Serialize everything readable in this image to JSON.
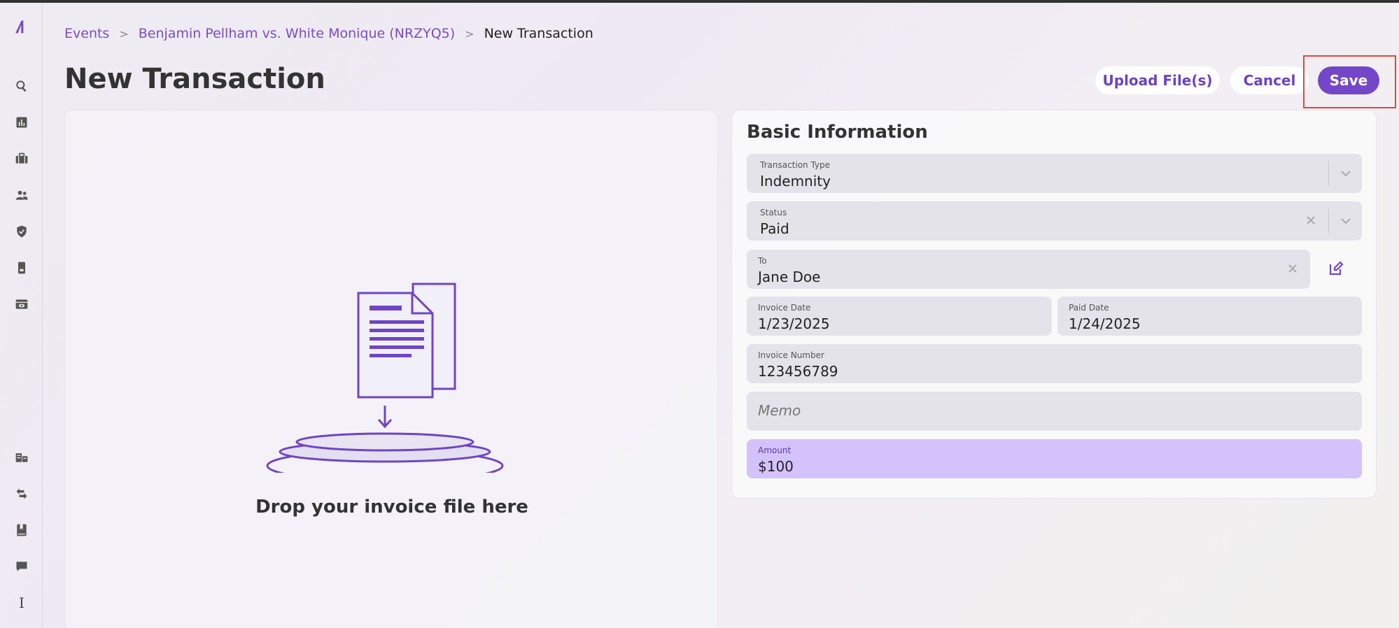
{
  "breadcrumb": {
    "items": [
      "Events",
      "Benjamin Pellham vs. White Monique (NRZYQ5)"
    ],
    "separator": ">",
    "current": "New Transaction"
  },
  "page": {
    "title": "New Transaction"
  },
  "actions": {
    "upload_label": "Upload File(s)",
    "cancel_label": "Cancel",
    "save_label": "Save"
  },
  "dropzone": {
    "text": "Drop your invoice file here"
  },
  "form": {
    "title": "Basic Information",
    "transaction_type": {
      "label": "Transaction Type",
      "value": "Indemnity"
    },
    "status": {
      "label": "Status",
      "value": "Paid"
    },
    "to": {
      "label": "To",
      "value": "Jane Doe"
    },
    "invoice_date": {
      "label": "Invoice Date",
      "value": "1/23/2025"
    },
    "paid_date": {
      "label": "Paid Date",
      "value": "1/24/2025"
    },
    "invoice_number": {
      "label": "Invoice Number",
      "value": "123456789"
    },
    "memo": {
      "placeholder": "Memo"
    },
    "amount": {
      "label": "Amount",
      "value": "$100"
    }
  },
  "sidebar": {
    "icons": [
      "logo-icon",
      "search-icon",
      "chart-icon",
      "briefcase-icon",
      "users-icon",
      "shield-icon",
      "device-icon",
      "eye-card-icon",
      "building-icon",
      "transfer-icon",
      "book-icon",
      "chat-icon",
      "text-cursor-icon"
    ],
    "bottom_text": "I"
  },
  "colors": {
    "accent": "#7447c8",
    "link": "#7a4cc9",
    "highlight": "#e2463a",
    "amount_bg": "#d3c2fb"
  }
}
